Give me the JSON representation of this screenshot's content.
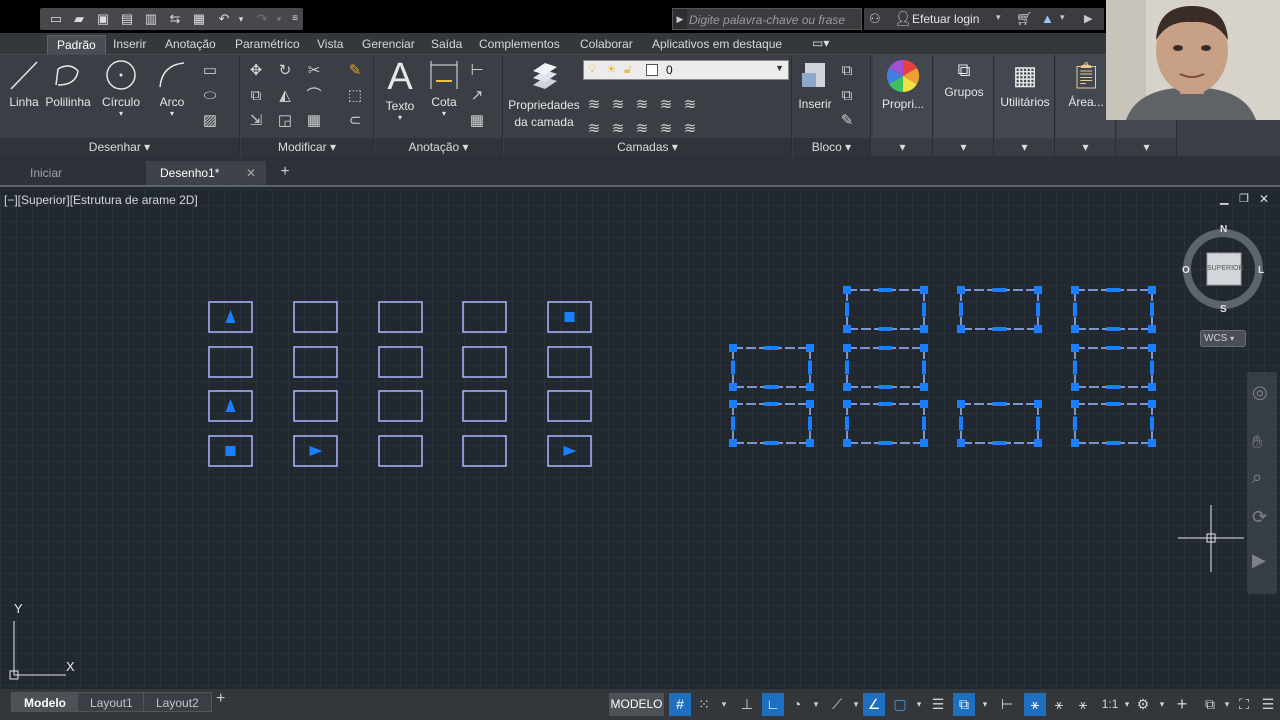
{
  "search": {
    "placeholder": "Digite palavra-chave ou frase"
  },
  "login": {
    "label": "Efetuar login"
  },
  "ribbon_tabs": [
    "Padrão",
    "Inserir",
    "Anotação",
    "Paramétrico",
    "Vista",
    "Gerenciar",
    "Saída",
    "Complementos",
    "Colaborar",
    "Aplicativos em destaque"
  ],
  "draw": {
    "linha": "Linha",
    "polilinha": "Polilinha",
    "circulo": "Círculo",
    "arco": "Arco",
    "panel_label": "Desenhar"
  },
  "modify": {
    "panel_label": "Modificar"
  },
  "annotation": {
    "texto": "Texto",
    "cota": "Cota",
    "panel_label": "Anotação"
  },
  "layers": {
    "props_line1": "Propriedades",
    "props_line2": "da camada",
    "current_layer": "0",
    "panel_label": "Camadas"
  },
  "block": {
    "inserir": "Inserir",
    "panel_label": "Bloco"
  },
  "extra": {
    "propri": "Propri...",
    "grupos": "Grupos",
    "utilitarios": "Utilitários",
    "area": "Área..."
  },
  "file_tabs": {
    "iniciar": "Iniciar",
    "desenho": "Desenho1*"
  },
  "viewport": {
    "label": "[−][Superior][Estrutura de arame 2D]"
  },
  "viewcube": {
    "n": "N",
    "s": "S",
    "o": "O",
    "l": "L",
    "face": "SUPERIOR"
  },
  "wcs": "WCS",
  "ucs": {
    "x": "X",
    "y": "Y"
  },
  "layout_tabs": [
    "Modelo",
    "Layout1",
    "Layout2"
  ],
  "status": {
    "model": "MODELO",
    "scale": "1:1"
  },
  "colors": {
    "accent": "#1a86ff",
    "rect_stroke": "#a9b9ff",
    "grip": "#1a7fff",
    "bg": "#212830"
  }
}
